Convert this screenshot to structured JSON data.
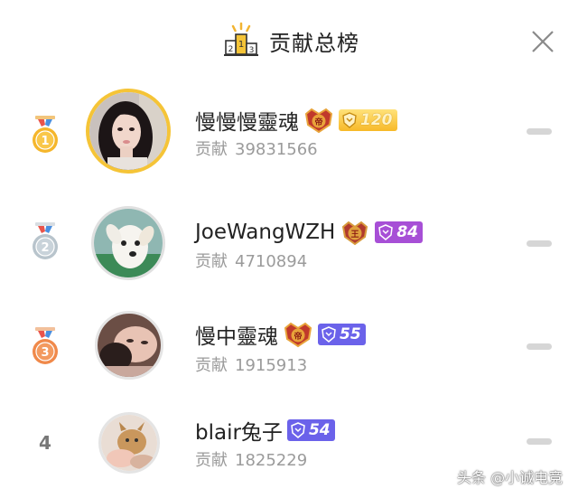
{
  "header": {
    "title": "贡献总榜",
    "podium_icon": "podium-icon",
    "close_icon": "close-icon"
  },
  "contribution_label": "贡献",
  "entries": [
    {
      "rank": "1",
      "name": "慢慢慢靈魂",
      "badge": "emperor-crest-icon",
      "level": "120",
      "level_style": "gold",
      "contribution": "39831566",
      "avatar": "avatar-woman"
    },
    {
      "rank": "2",
      "name": "JoeWangWZH",
      "badge": "king-crest-icon",
      "level": "84",
      "level_style": "purple",
      "contribution": "4710894",
      "avatar": "avatar-dog"
    },
    {
      "rank": "3",
      "name": "慢中靈魂",
      "badge": "emperor-crest-icon",
      "level": "55",
      "level_style": "blue",
      "contribution": "1915913",
      "avatar": "avatar-person"
    },
    {
      "rank": "4",
      "name": "blair兔子",
      "badge": "",
      "level": "54",
      "level_style": "blue",
      "contribution": "1825229",
      "avatar": "avatar-cat"
    }
  ],
  "colors": {
    "gold_medal": "#f5b62b",
    "silver_medal": "#b8c4cc",
    "bronze_medal": "#f0894a",
    "level_gold": "#f7b928",
    "level_purple": "#a74fd6",
    "level_blue": "#6b62ea"
  },
  "watermark": "头条 @小诚电竞"
}
